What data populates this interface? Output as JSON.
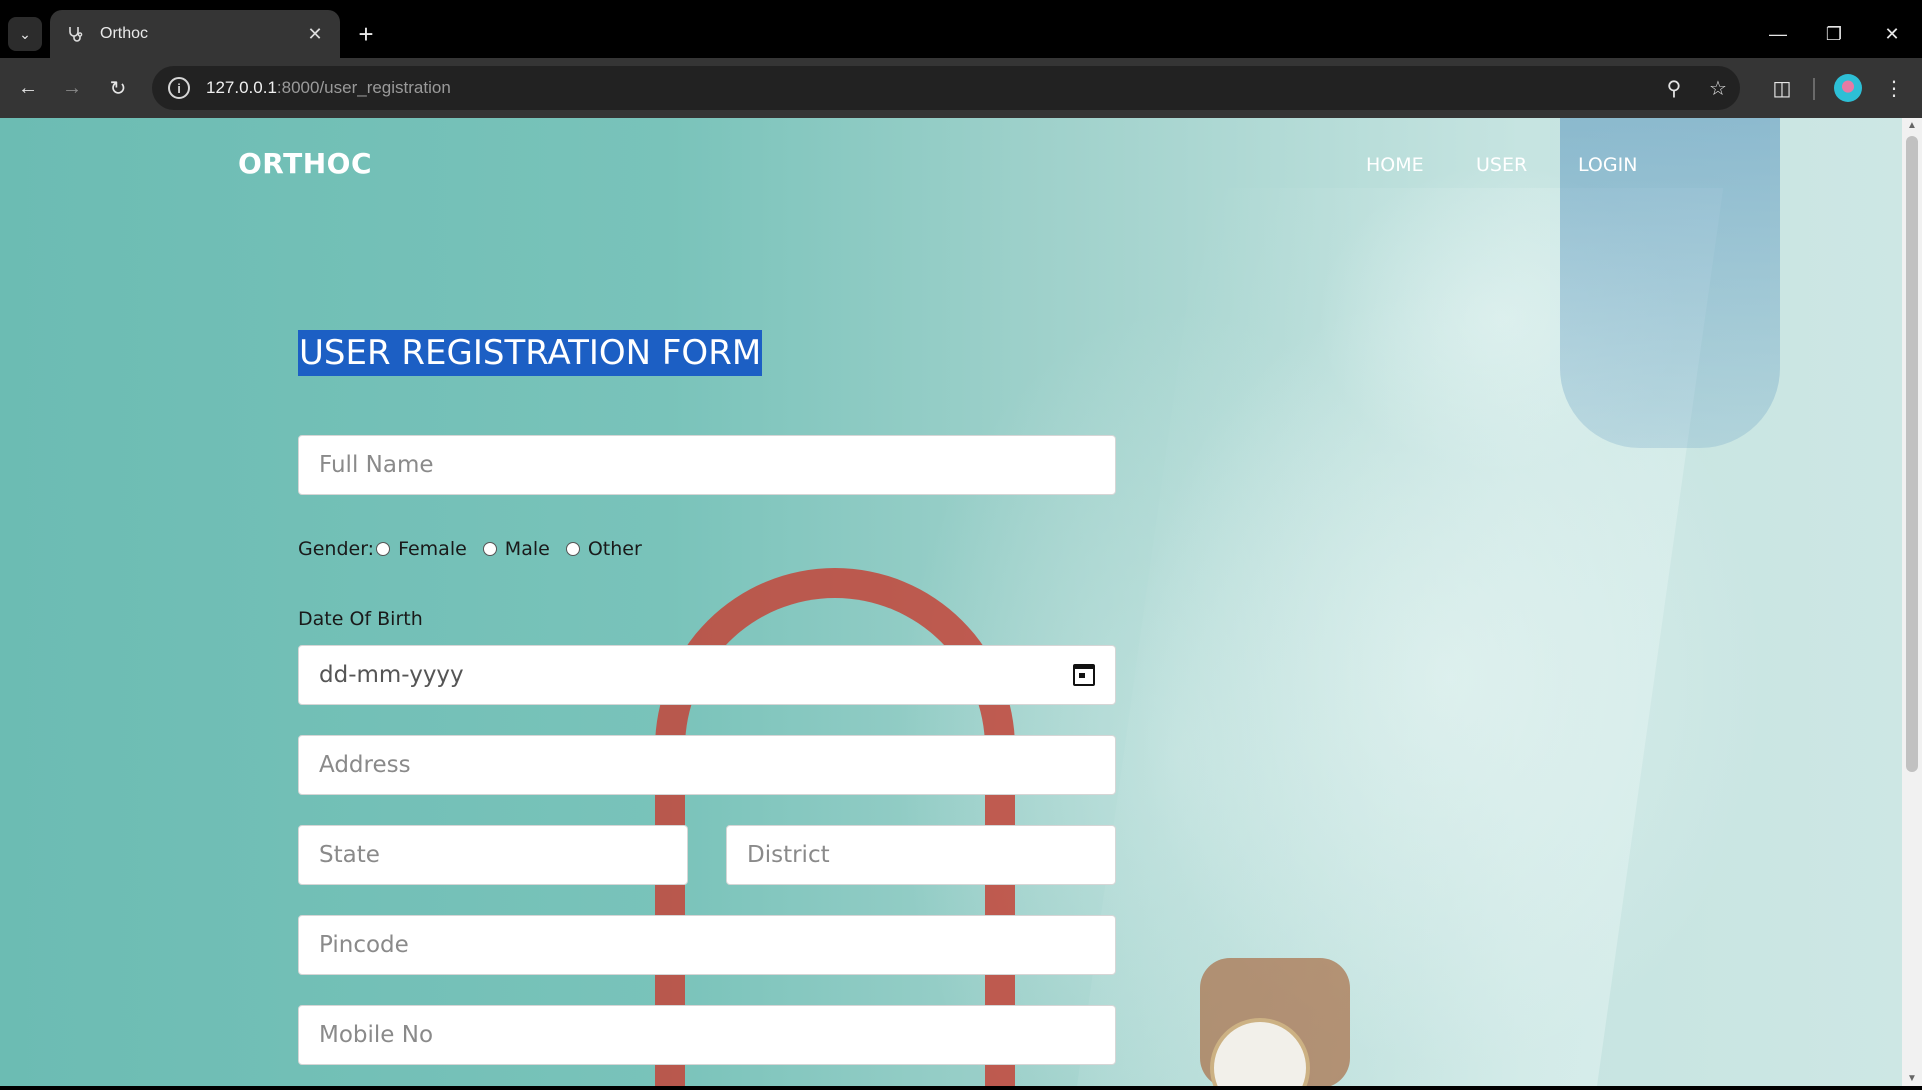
{
  "browser": {
    "tab_title": "Orthoc",
    "url_host": "127.0.0.1",
    "url_rest": ":8000/user_registration"
  },
  "site": {
    "brand": "ORTHOC",
    "nav": [
      "HOME",
      "USER",
      "LOGIN"
    ]
  },
  "form": {
    "title": "USER REGISTRATION FORM",
    "full_name_placeholder": "Full Name",
    "gender_label": "Gender:",
    "gender_options": [
      "Female",
      "Male",
      "Other"
    ],
    "dob_label": "Date Of Birth",
    "dob_placeholder": "dd-mm-yyyy",
    "address_placeholder": "Address",
    "state_placeholder": "State",
    "district_placeholder": "District",
    "pincode_placeholder": "Pincode",
    "mobile_placeholder": "Mobile No"
  }
}
